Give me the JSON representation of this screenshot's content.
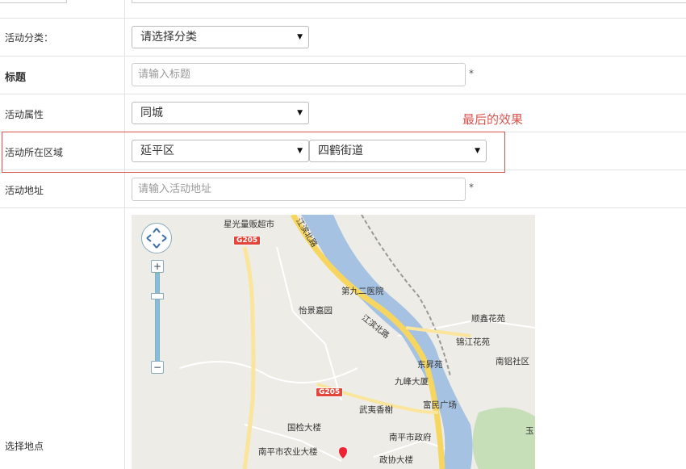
{
  "form": {
    "category": {
      "label": "活动分类：",
      "value": "请选择分类"
    },
    "title": {
      "label": "标题",
      "placeholder": "请输入标题",
      "required_mark": "*"
    },
    "attribute": {
      "label": "活动属性",
      "value": "同城"
    },
    "region": {
      "label": "活动所在区域",
      "district": "延平区",
      "street": "四鹤街道"
    },
    "address": {
      "label": "活动地址",
      "placeholder": "请输入活动地址",
      "required_mark": "*"
    },
    "location": {
      "label": "选择地点"
    }
  },
  "annotation": {
    "text": "最后的效果",
    "color": "#d9534f"
  },
  "map": {
    "roads": {
      "r1": "G205",
      "r2": "G205",
      "r3": "江滨北路",
      "r4": "江滨北路"
    },
    "pois": {
      "p1": "星光量贩超市",
      "p2": "第九二医院",
      "p3": "怡景嘉园",
      "p4": "顺鑫花苑",
      "p5": "锦江花苑",
      "p6": "南铝社区",
      "p7": "东昇苑",
      "p8": "九峰大厦",
      "p9": "武夷香榭",
      "p10": "富民广场",
      "p11": "国检大楼",
      "p12": "南平市政府",
      "p13": "南平市农业大楼",
      "p14": "政协大楼",
      "p15": "玉"
    },
    "zoom_in": "+",
    "zoom_out": "−"
  }
}
